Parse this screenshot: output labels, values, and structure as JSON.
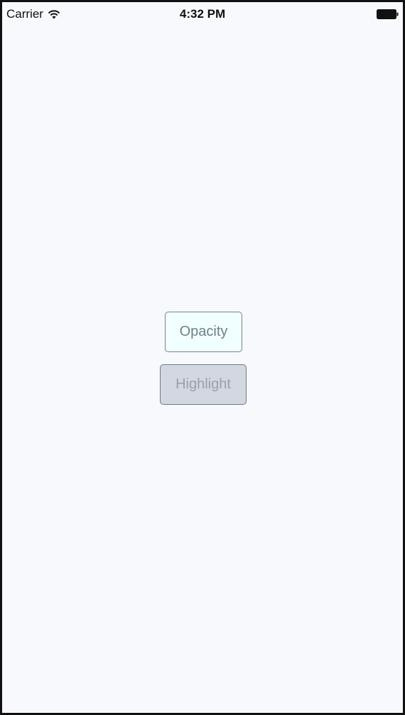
{
  "status_bar": {
    "carrier": "Carrier",
    "time": "4:32 PM",
    "wifi_icon": "wifi-icon",
    "battery_icon": "battery-full-icon"
  },
  "buttons": {
    "opacity_label": "Opacity",
    "highlight_label": "Highlight"
  },
  "colors": {
    "background": "#f8f9fd",
    "opacity_button_bg": "#f2ffff",
    "highlight_button_bg": "#d3d7e0",
    "button_text": "#6e8185"
  }
}
